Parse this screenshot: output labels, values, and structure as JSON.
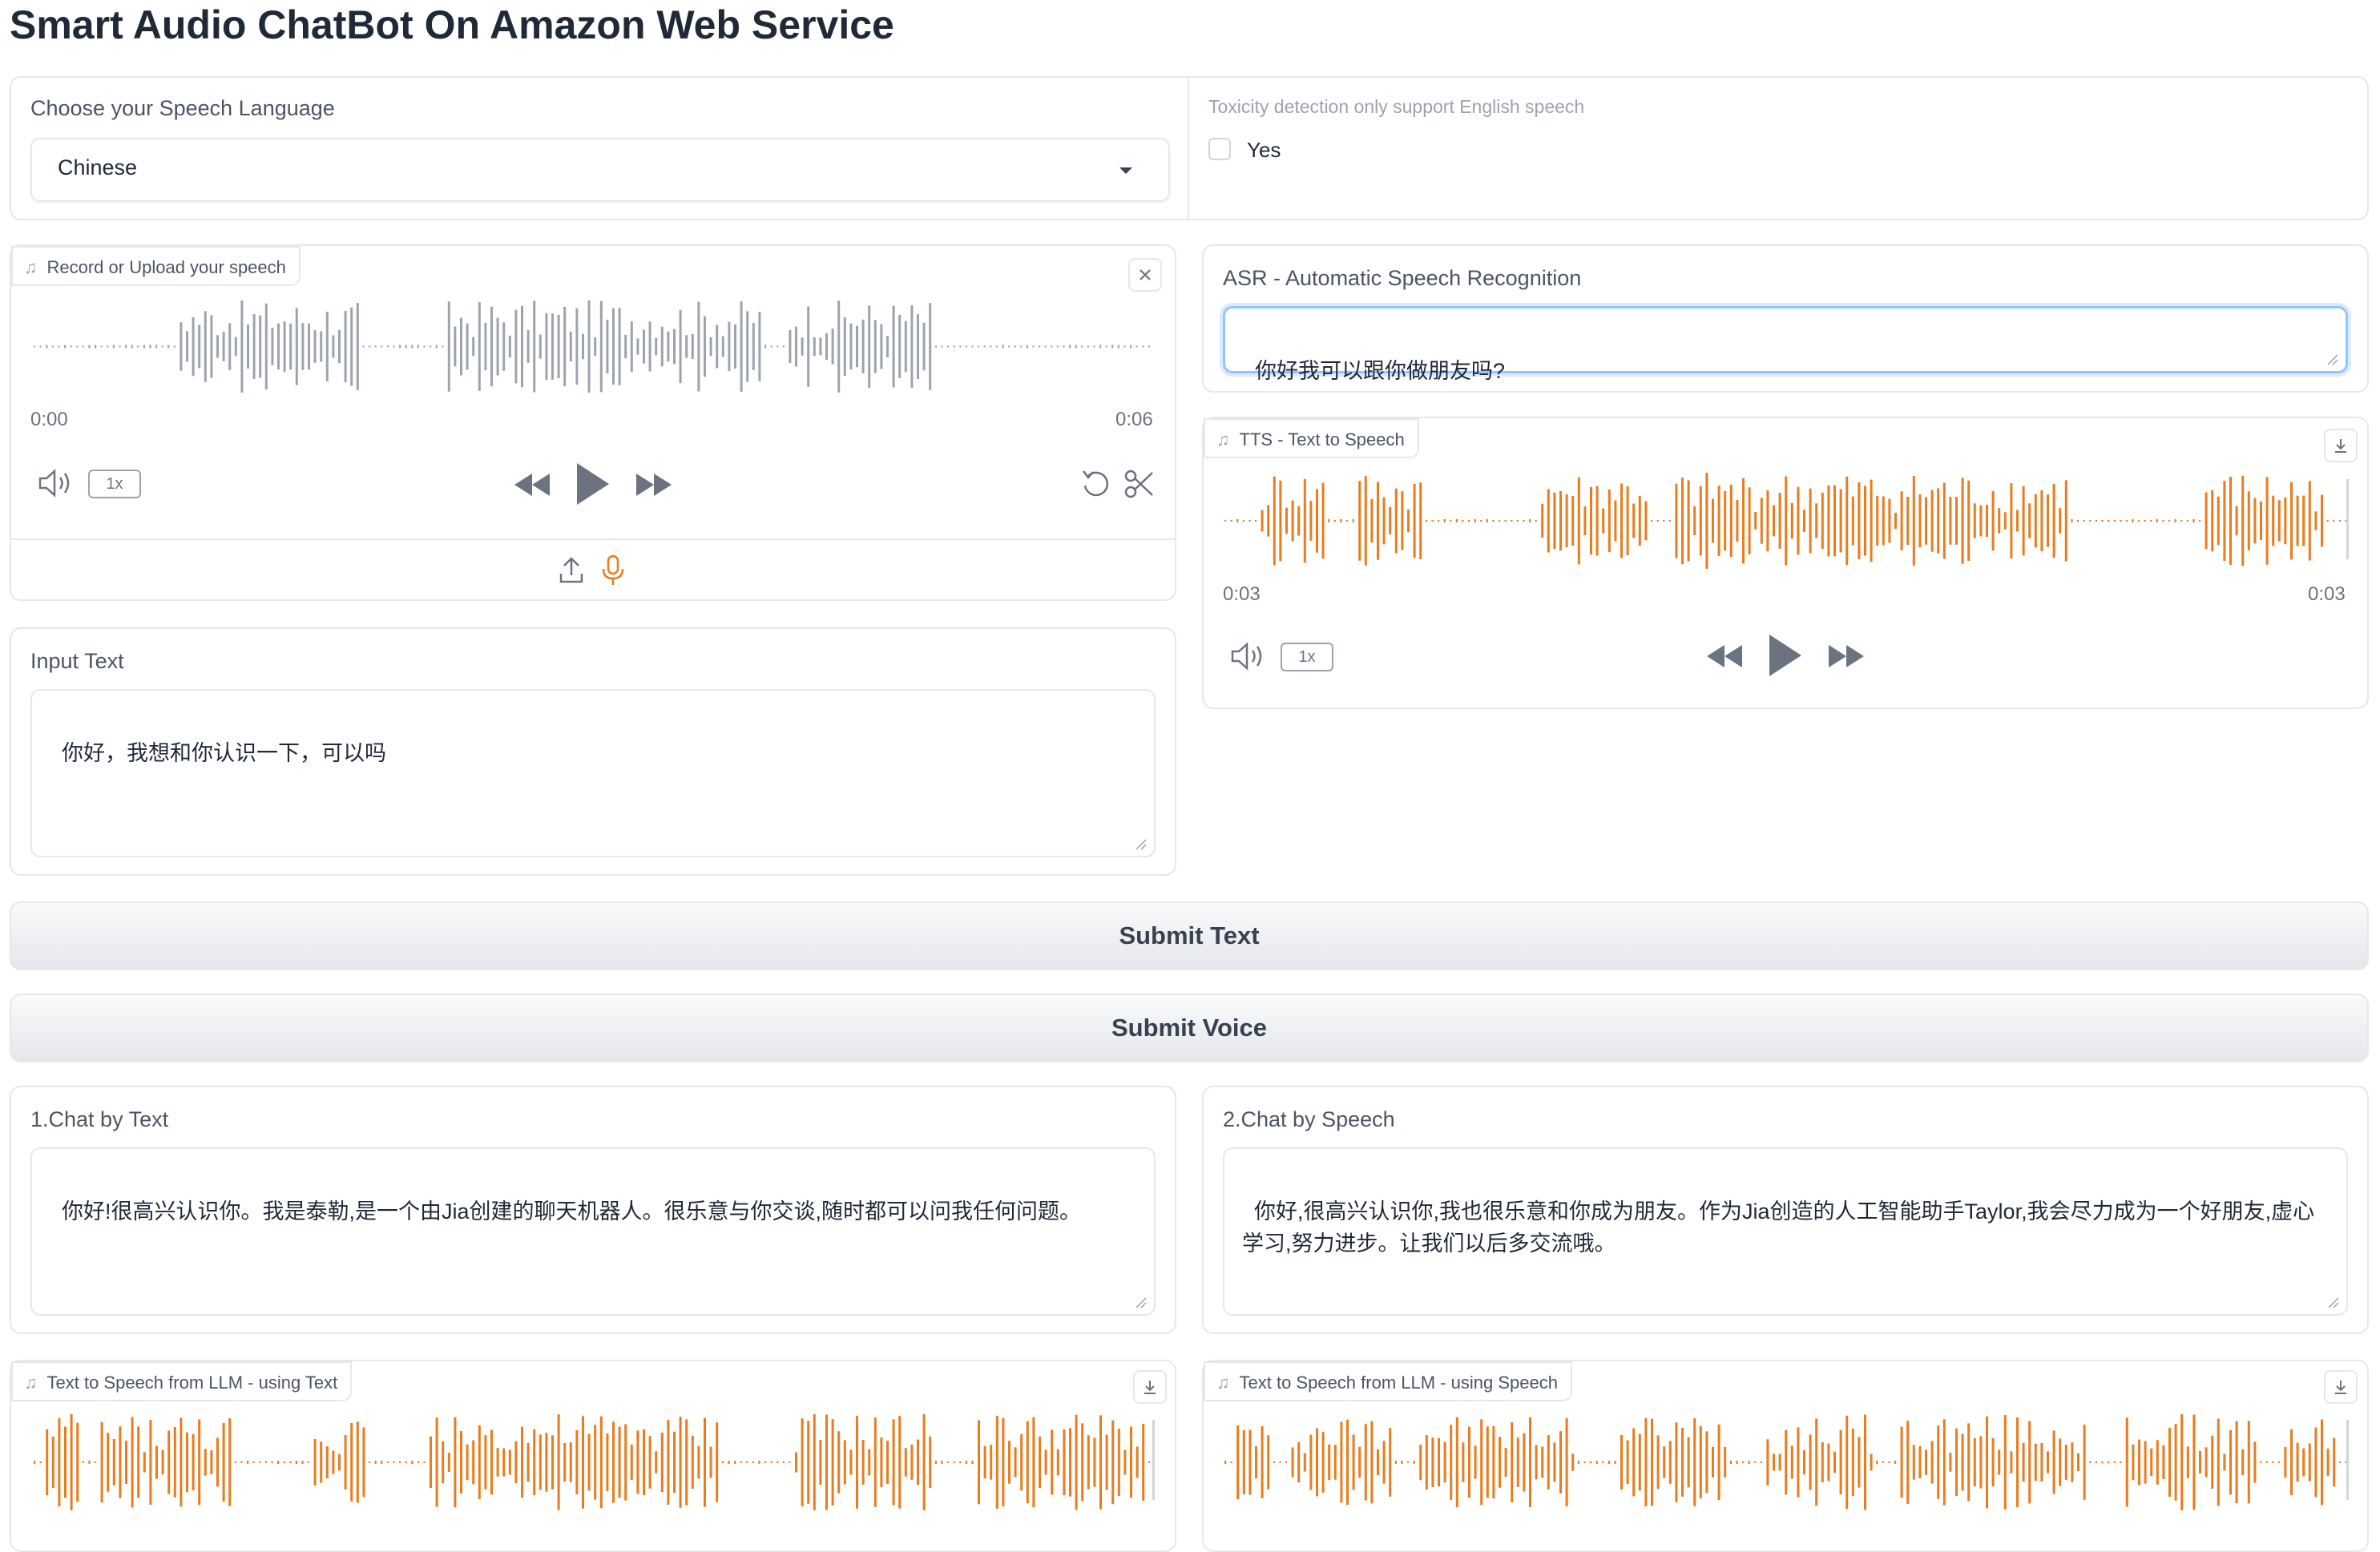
{
  "app": {
    "title": "Smart Audio ChatBot On Amazon Web Service"
  },
  "colors": {
    "accent": "#ea7c1d",
    "wave_gray": "#9ca3af",
    "focus": "#93c5fd"
  },
  "language": {
    "label": "Choose your Speech Language",
    "value": "Chinese"
  },
  "toxicity": {
    "label": "Toxicity detection only support English speech",
    "option": "Yes",
    "checked": false
  },
  "record": {
    "tag": "Record or Upload your speech",
    "time_start": "0:00",
    "time_end": "0:06",
    "speed": "1x",
    "icons": [
      "music-note-icon",
      "close-icon",
      "volume-icon",
      "rewind-icon",
      "play-icon",
      "fast-forward-icon",
      "undo-icon",
      "scissors-icon",
      "upload-icon",
      "microphone-icon"
    ]
  },
  "asr": {
    "label": "ASR - Automatic Speech Recognition",
    "value": "你好我可以跟你做朋友吗?"
  },
  "tts": {
    "tag": "TTS - Text to Speech",
    "time_start": "0:03",
    "time_end": "0:03",
    "speed": "1x"
  },
  "input_text": {
    "label": "Input Text",
    "value": "你好，我想和你认识一下，可以吗"
  },
  "buttons": {
    "submit_text": "Submit Text",
    "submit_voice": "Submit Voice"
  },
  "chat_text": {
    "label": "1.Chat by Text",
    "value": "你好!很高兴认识你。我是泰勒,是一个由Jia创建的聊天机器人。很乐意与你交谈,随时都可以问我任何问题。"
  },
  "chat_speech": {
    "label": "2.Chat by Speech",
    "value": "你好,很高兴认识你,我也很乐意和你成为朋友。作为Jia创造的人工智能助手Taylor,我会尽力成为一个好朋友,虚心学习,努力进步。让我们以后多交流哦。"
  },
  "llm_text_audio": {
    "tag": "Text to Speech from LLM - using Text"
  },
  "llm_speech_audio": {
    "tag": "Text to Speech from LLM - using Speech"
  }
}
